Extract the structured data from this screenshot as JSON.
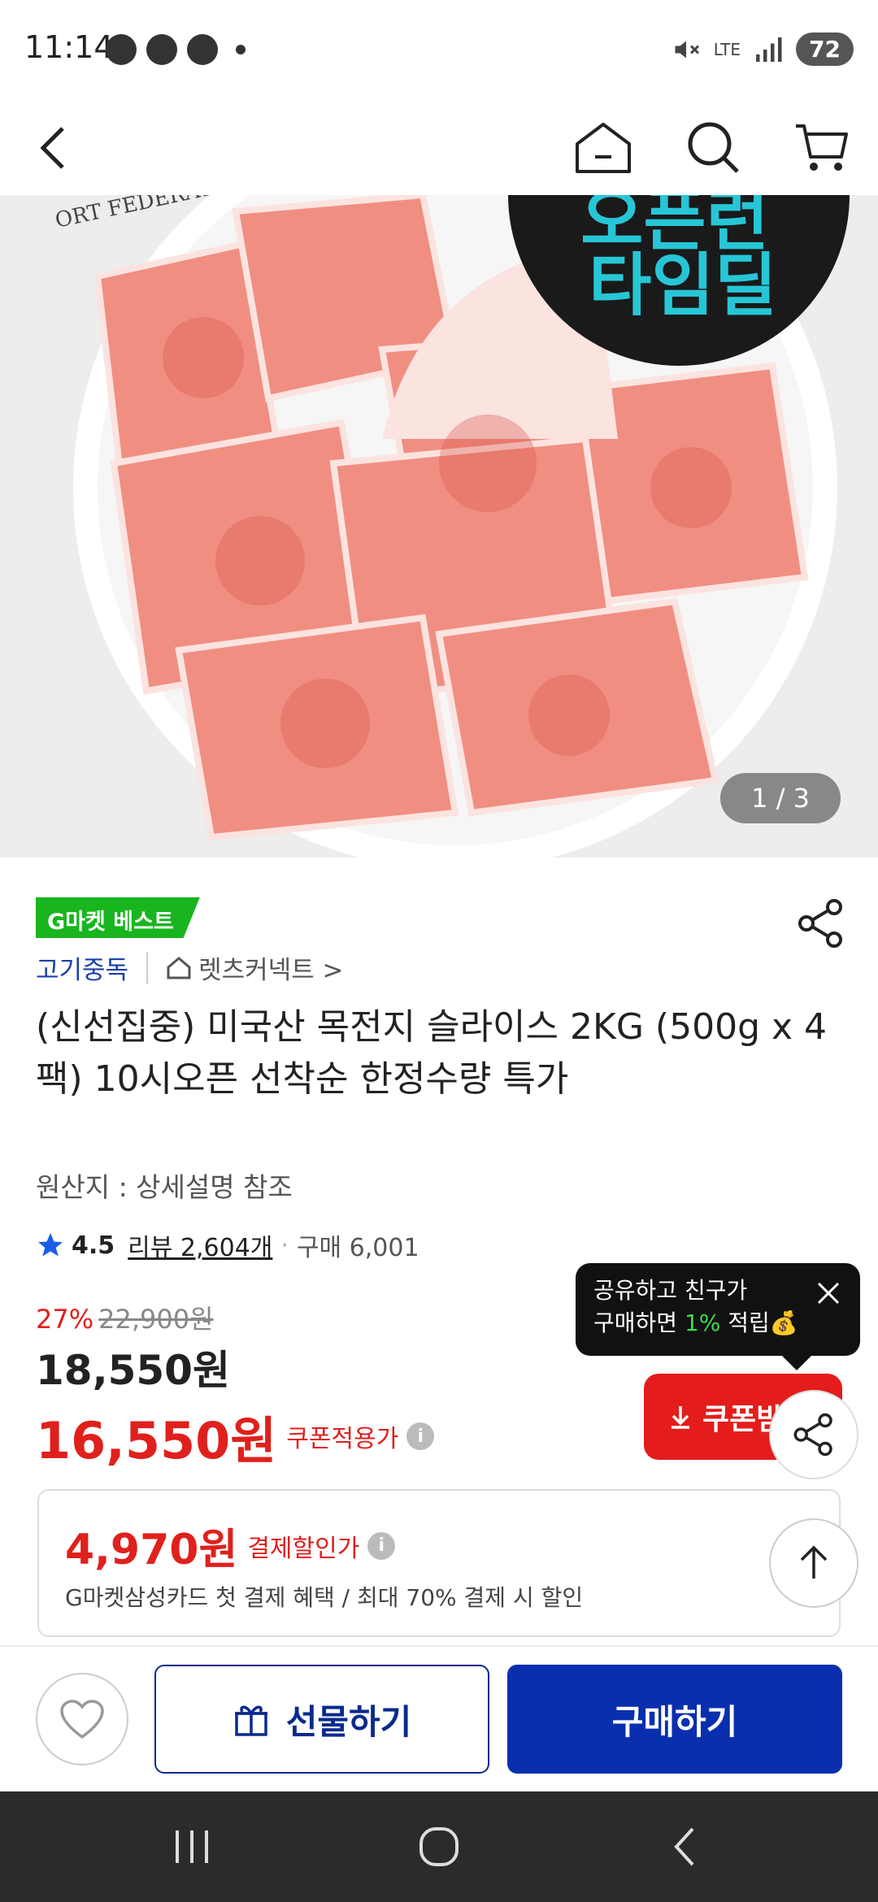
{
  "status_bar": {
    "time": "11:14",
    "network": "LTE",
    "battery": "72"
  },
  "hero": {
    "counter": "1 / 3",
    "banner_line1": "오픈런",
    "banner_line2": "타임딜",
    "plate_text": "ORT FEDERAT"
  },
  "product": {
    "badge": "G마켓 베스트",
    "category": "고기중독",
    "store": "렛츠커넥트 >",
    "title": "(신선집중) 미국산 목전지 슬라이스 2KG (500g x 4팩) 10시오픈 선착순 한정수량 특가",
    "origin": "원산지 : 상세설명 참조",
    "rating": "4.5",
    "reviews": "리뷰 2,604개",
    "purchases": "구매 6,001"
  },
  "pricing": {
    "discount_rate": "27%",
    "original_price": "22,900원",
    "price": "18,550원",
    "coupon_price": "16,550원",
    "coupon_label": "쿠폰적용가",
    "coupon_button": "쿠폰받"
  },
  "tooltip": {
    "line1": "공유하고 친구가",
    "line2_a": "구매하면 ",
    "line2_pct": "1%",
    "line2_b": " 적립💰"
  },
  "card_promo": {
    "amount": "4,970원",
    "label": "결제할인가",
    "description": "G마켓삼성카드 첫 결제 혜택 / 최대 70% 결제 시 할인"
  },
  "actions": {
    "gift": "선물하기",
    "buy": "구매하기"
  },
  "colors": {
    "accent_red": "#e0201c",
    "brand_blue": "#0a2fae",
    "badge_green": "#19b51f"
  }
}
